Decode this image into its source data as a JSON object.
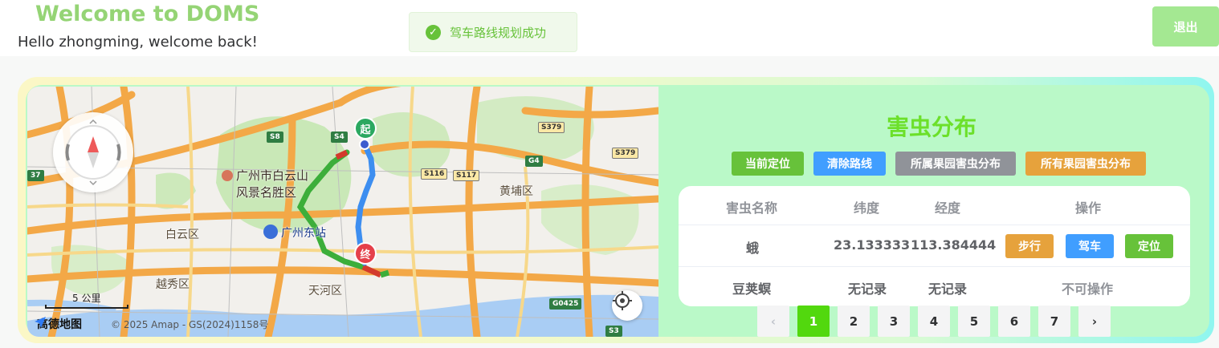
{
  "header": {
    "title": "Welcome to DOMS",
    "subtitle": "Hello zhongming, welcome back!",
    "logout_label": "退出"
  },
  "toast": {
    "message": "驾车路线规划成功",
    "icon": "check-circle-icon",
    "color": "#67c23a"
  },
  "map": {
    "labels": {
      "poi": "广州市白云山\n风景名胜区",
      "poi_line1": "广州市白云山",
      "poi_line2": "风景名胜区",
      "baiyun": "白云区",
      "yuexiu": "越秀区",
      "tianhe": "天河区",
      "huangpu": "黄埔区",
      "station": "广州东站"
    },
    "roads": [
      "S8",
      "S4",
      "S379",
      "S379",
      "G4",
      "S116",
      "S117",
      "G0425",
      "S3",
      "37"
    ],
    "start_marker": "起",
    "end_marker": "终",
    "scale": "5 公里",
    "logo": "高德地图",
    "copyright": "© 2025 Amap - GS(2024)1158号"
  },
  "panel": {
    "title": "害虫分布",
    "buttons": [
      {
        "label": "当前定位",
        "color": "#67c23a"
      },
      {
        "label": "清除路线",
        "color": "#409eff"
      },
      {
        "label": "所属果园害虫分布",
        "color": "#909399"
      },
      {
        "label": "所有果园害虫分布",
        "color": "#e6a23c"
      }
    ],
    "table": {
      "headers": [
        "害虫名称",
        "纬度",
        "经度",
        "操作"
      ],
      "rows": [
        {
          "name": "蛾",
          "lat": "23.133333",
          "lng": "113.384444",
          "actions": [
            "步行",
            "驾车",
            "定位"
          ]
        },
        {
          "name": "豆荚螟",
          "lat": "无记录",
          "lng": "无记录",
          "actions_text": "不可操作"
        }
      ]
    },
    "pagination": {
      "prev": "‹",
      "next": "›",
      "pages": [
        "1",
        "2",
        "3",
        "4",
        "5",
        "6",
        "7"
      ],
      "current": 1,
      "accent": "#52d80e"
    }
  }
}
